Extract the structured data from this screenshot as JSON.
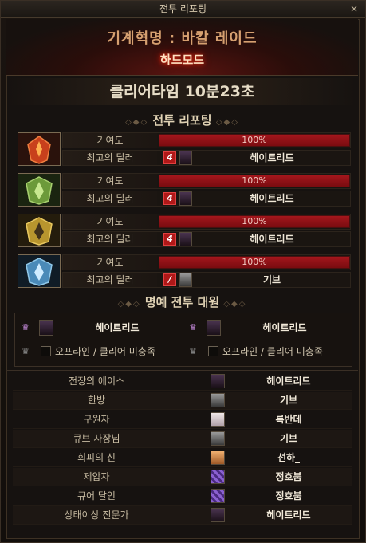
{
  "window": {
    "title": "전투 리포팅",
    "close_icon": "×"
  },
  "header": {
    "dungeon_title": "기계혁명 : 바칼 레이드",
    "difficulty": "하드모드"
  },
  "clear_time": "클리어타임   10분23초",
  "report_section": {
    "title": "전투 리포팅"
  },
  "bosses": [
    {
      "icon": "boss-red-icon",
      "icon_color": "#c8401c",
      "contribution_label": "기여도",
      "contribution_text": "100%",
      "contribution_value": 100,
      "dealer_label": "최고의 딜러",
      "class_badge": "4",
      "dealer_name": "헤이트리드"
    },
    {
      "icon": "boss-green-icon",
      "icon_color": "#6c9a3a",
      "contribution_label": "기여도",
      "contribution_text": "100%",
      "contribution_value": 100,
      "dealer_label": "최고의 딜러",
      "class_badge": "4",
      "dealer_name": "헤이트리드"
    },
    {
      "icon": "boss-gold-icon",
      "icon_color": "#b8952e",
      "contribution_label": "기여도",
      "contribution_text": "100%",
      "contribution_value": 100,
      "dealer_label": "최고의 딜러",
      "class_badge": "4",
      "dealer_name": "헤이트리드"
    },
    {
      "icon": "boss-blue-icon",
      "icon_color": "#4a8ab8",
      "contribution_label": "기여도",
      "contribution_text": "100%",
      "contribution_value": 100,
      "dealer_label": "최고의 딜러",
      "class_badge": "/",
      "dealer_name": "기브"
    }
  ],
  "honor_section": {
    "title": "명예 전투 대원",
    "members": [
      {
        "name": "헤이트리드",
        "status": ""
      },
      {
        "name": "헤이트리드",
        "status": ""
      },
      {
        "name": "",
        "status": "오프라인 / 클리어 미충족"
      },
      {
        "name": "",
        "status": "오프라인 / 클리어 미충족"
      }
    ]
  },
  "awards": [
    {
      "title": "전장의 에이스",
      "name": "헤이트리드",
      "avatar": "dark-avatar"
    },
    {
      "title": "한방",
      "name": "기브",
      "avatar": "gray-avatar"
    },
    {
      "title": "구원자",
      "name": "록반데",
      "avatar": "white-avatar"
    },
    {
      "title": "큐브 사장님",
      "name": "기브",
      "avatar": "gray-avatar"
    },
    {
      "title": "회피의 신",
      "name": "선하_",
      "avatar": "orange-avatar"
    },
    {
      "title": "제압자",
      "name": "정호붐",
      "avatar": "purple-avatar"
    },
    {
      "title": "큐어 달인",
      "name": "정호붐",
      "avatar": "purple-avatar"
    },
    {
      "title": "상태이상 전문가",
      "name": "헤이트리드",
      "avatar": "dark-avatar"
    }
  ]
}
